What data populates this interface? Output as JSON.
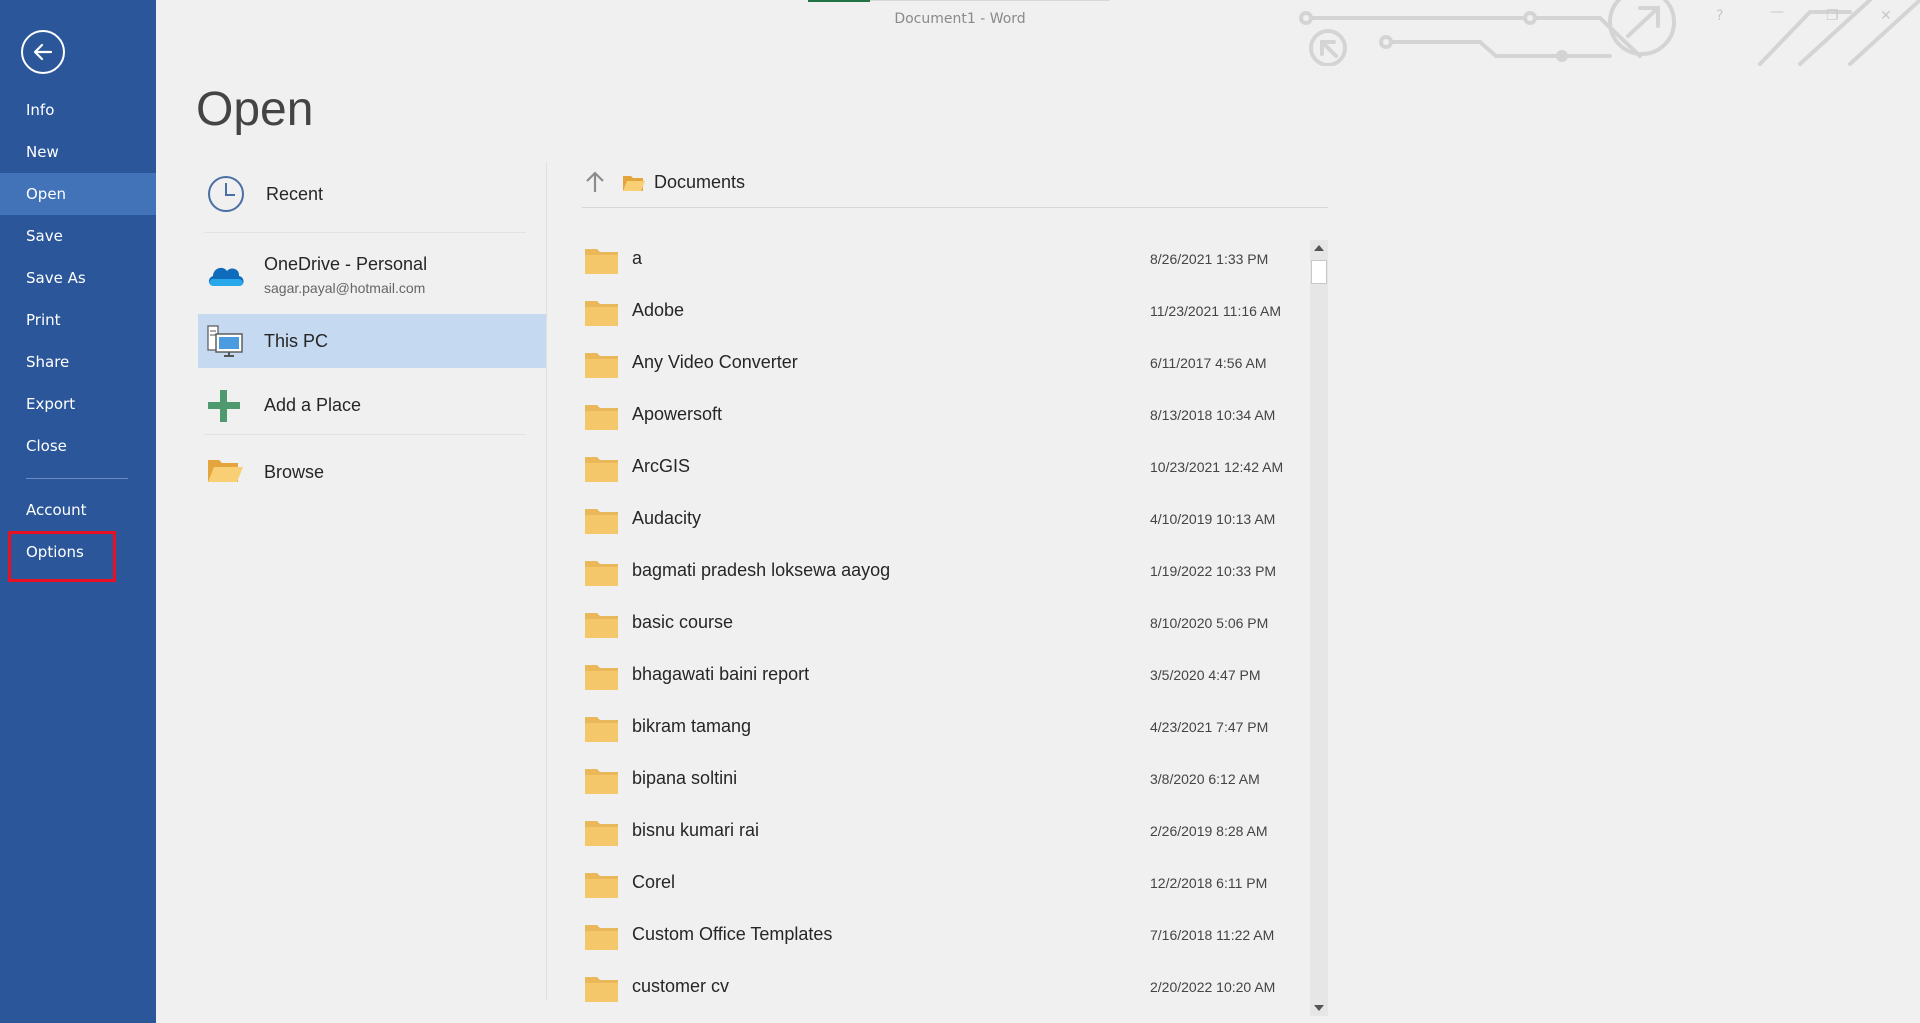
{
  "window": {
    "title": "Document1 - Word",
    "controls": {
      "help": "?",
      "minimize": "—",
      "restore": "❐",
      "close": "✕"
    }
  },
  "nav": {
    "items": [
      {
        "label": "Info"
      },
      {
        "label": "New"
      },
      {
        "label": "Open",
        "active": true
      },
      {
        "label": "Save"
      },
      {
        "label": "Save As"
      },
      {
        "label": "Print"
      },
      {
        "label": "Share"
      },
      {
        "label": "Export"
      },
      {
        "label": "Close"
      }
    ],
    "bottom_items": [
      {
        "label": "Account"
      },
      {
        "label": "Options",
        "highlighted": true
      }
    ]
  },
  "page": {
    "title": "Open"
  },
  "locations": [
    {
      "label": "Recent",
      "icon": "clock-icon"
    },
    {
      "label": "OneDrive - Personal",
      "sub": "sagar.payal@hotmail.com",
      "icon": "onedrive-cloud-icon"
    },
    {
      "label": "This PC",
      "icon": "computer-icon",
      "selected": true
    },
    {
      "label": "Add a Place",
      "icon": "plus-icon"
    },
    {
      "label": "Browse",
      "icon": "folder-open-icon"
    }
  ],
  "path": {
    "label": "Documents"
  },
  "files": [
    {
      "name": "a",
      "date": "8/26/2021 1:33 PM"
    },
    {
      "name": "Adobe",
      "date": "11/23/2021 11:16 AM"
    },
    {
      "name": "Any Video Converter",
      "date": "6/11/2017 4:56 AM"
    },
    {
      "name": "Apowersoft",
      "date": "8/13/2018 10:34 AM"
    },
    {
      "name": "ArcGIS",
      "date": "10/23/2021 12:42 AM"
    },
    {
      "name": "Audacity",
      "date": "4/10/2019 10:13 AM"
    },
    {
      "name": "bagmati pradesh loksewa aayog",
      "date": "1/19/2022 10:33 PM"
    },
    {
      "name": "basic course",
      "date": "8/10/2020 5:06 PM"
    },
    {
      "name": "bhagawati baini report",
      "date": "3/5/2020 4:47 PM"
    },
    {
      "name": "bikram tamang",
      "date": "4/23/2021 7:47 PM"
    },
    {
      "name": "bipana soltini",
      "date": "3/8/2020 6:12 AM"
    },
    {
      "name": "bisnu kumari rai",
      "date": "2/26/2019 8:28 AM"
    },
    {
      "name": "Corel",
      "date": "12/2/2018 6:11 PM"
    },
    {
      "name": "Custom Office Templates",
      "date": "7/16/2018 11:22 AM"
    },
    {
      "name": "customer cv",
      "date": "2/20/2022 10:20 AM"
    }
  ],
  "colors": {
    "nav_bg": "#2b579a",
    "nav_active": "#4272b8",
    "selected_location": "#c5d9f1",
    "highlight": "#e81123",
    "folder": "#f4c76b"
  }
}
